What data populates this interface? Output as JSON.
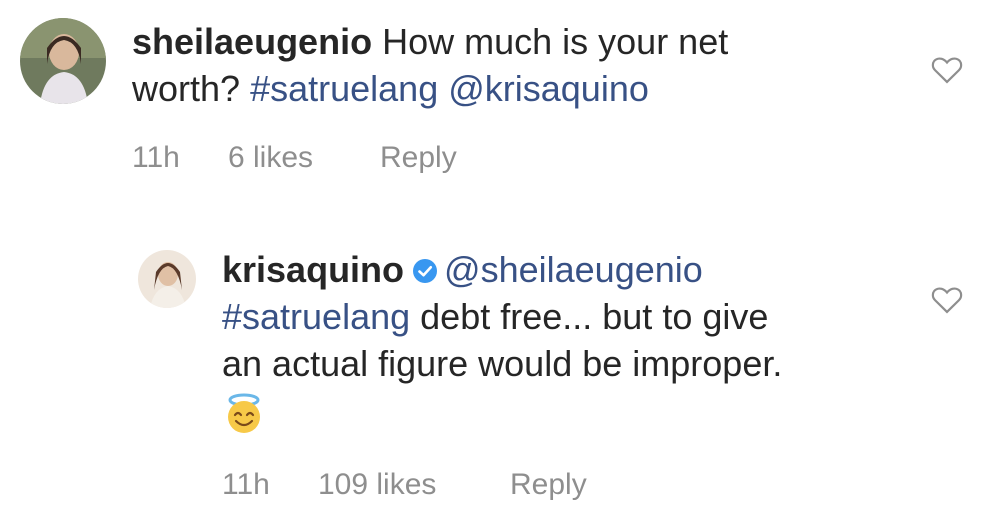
{
  "comments": [
    {
      "username": "sheilaeugenio",
      "text_line1": "How much is your net",
      "text_line2_plain": "worth?",
      "hashtag": "#satruelang",
      "mention": "@krisaquino",
      "time": "11h",
      "likes": "6 likes",
      "reply_label": "Reply",
      "avatar_icon": "profile-photo",
      "like_icon": "heart-outline-icon"
    },
    {
      "username": "krisaquino",
      "verified_icon": "verified-badge-icon",
      "mention": "@sheilaeugenio",
      "hashtag": "#satruelang",
      "text_after_hashtag": "debt free... but to give",
      "text_line3": "an actual figure would be improper.",
      "emoji": "innocent-face-emoji",
      "time": "11h",
      "likes": "109 likes",
      "reply_label": "Reply",
      "avatar_icon": "profile-photo",
      "like_icon": "heart-outline-icon"
    }
  ],
  "colors": {
    "text": "#262626",
    "link": "#385185",
    "meta": "#8e8e8e",
    "verified": "#3897f0"
  }
}
